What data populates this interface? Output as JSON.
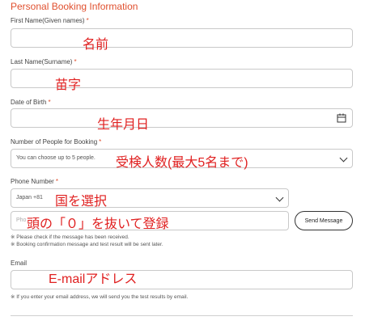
{
  "section": {
    "title": "Personal Booking Information"
  },
  "first_name": {
    "label": "First Name(Given names)",
    "required_mark": "*",
    "annotation": "名前"
  },
  "last_name": {
    "label": "Last Name(Surname)",
    "required_mark": "*",
    "annotation": "苗字"
  },
  "dob": {
    "label": "Date of Birth",
    "required_mark": "*",
    "annotation": "生年月日",
    "icon": "calendar-icon"
  },
  "people": {
    "label": "Number of People for Booking",
    "required_mark": "*",
    "value": "You can choose up to 5 people.",
    "annotation": "受検人数(最大5名まで)"
  },
  "phone": {
    "label": "Phone Number",
    "required_mark": "*",
    "country_value": "Japan +81",
    "country_annotation": "国を選択",
    "number_placeholder": "Pho",
    "number_annotation": "頭の「０」を抜いて登録",
    "send_label": "Send Message",
    "note1": "※ Please check if the message has been received.",
    "note2": "※ Booking confirmation message and test result will be sent later."
  },
  "email": {
    "label": "Email",
    "annotation": "E-mailアドレス",
    "note": "※ If you enter your email address, we will send you the test results by email."
  },
  "colors": {
    "accent": "#e0502f",
    "annotation": "#e02020"
  }
}
